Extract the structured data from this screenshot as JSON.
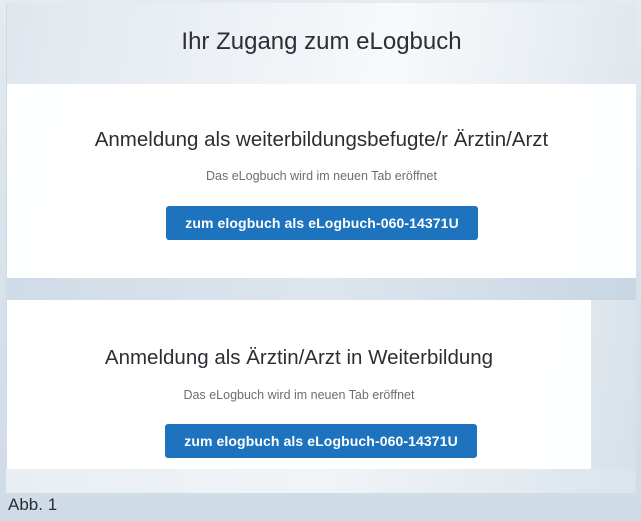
{
  "header": {
    "title": "Ihr Zugang zum eLogbuch"
  },
  "cards": [
    {
      "title": "Anmeldung als weiterbildungsbefugte/r Ärztin/Arzt",
      "subtitle": "Das eLogbuch wird im neuen Tab eröffnet",
      "button_label": "zum elogbuch als eLogbuch-060-14371U"
    },
    {
      "title": "Anmeldung als Ärztin/Arzt in Weiterbildung",
      "subtitle": "Das eLogbuch wird im neuen Tab eröffnet",
      "button_label": "zum elogbuch als eLogbuch-060-14371U"
    }
  ],
  "caption": "Abb. 1",
  "colors": {
    "button": "#1d73bd",
    "text": "#2b2f33",
    "muted": "#6a6f74"
  }
}
